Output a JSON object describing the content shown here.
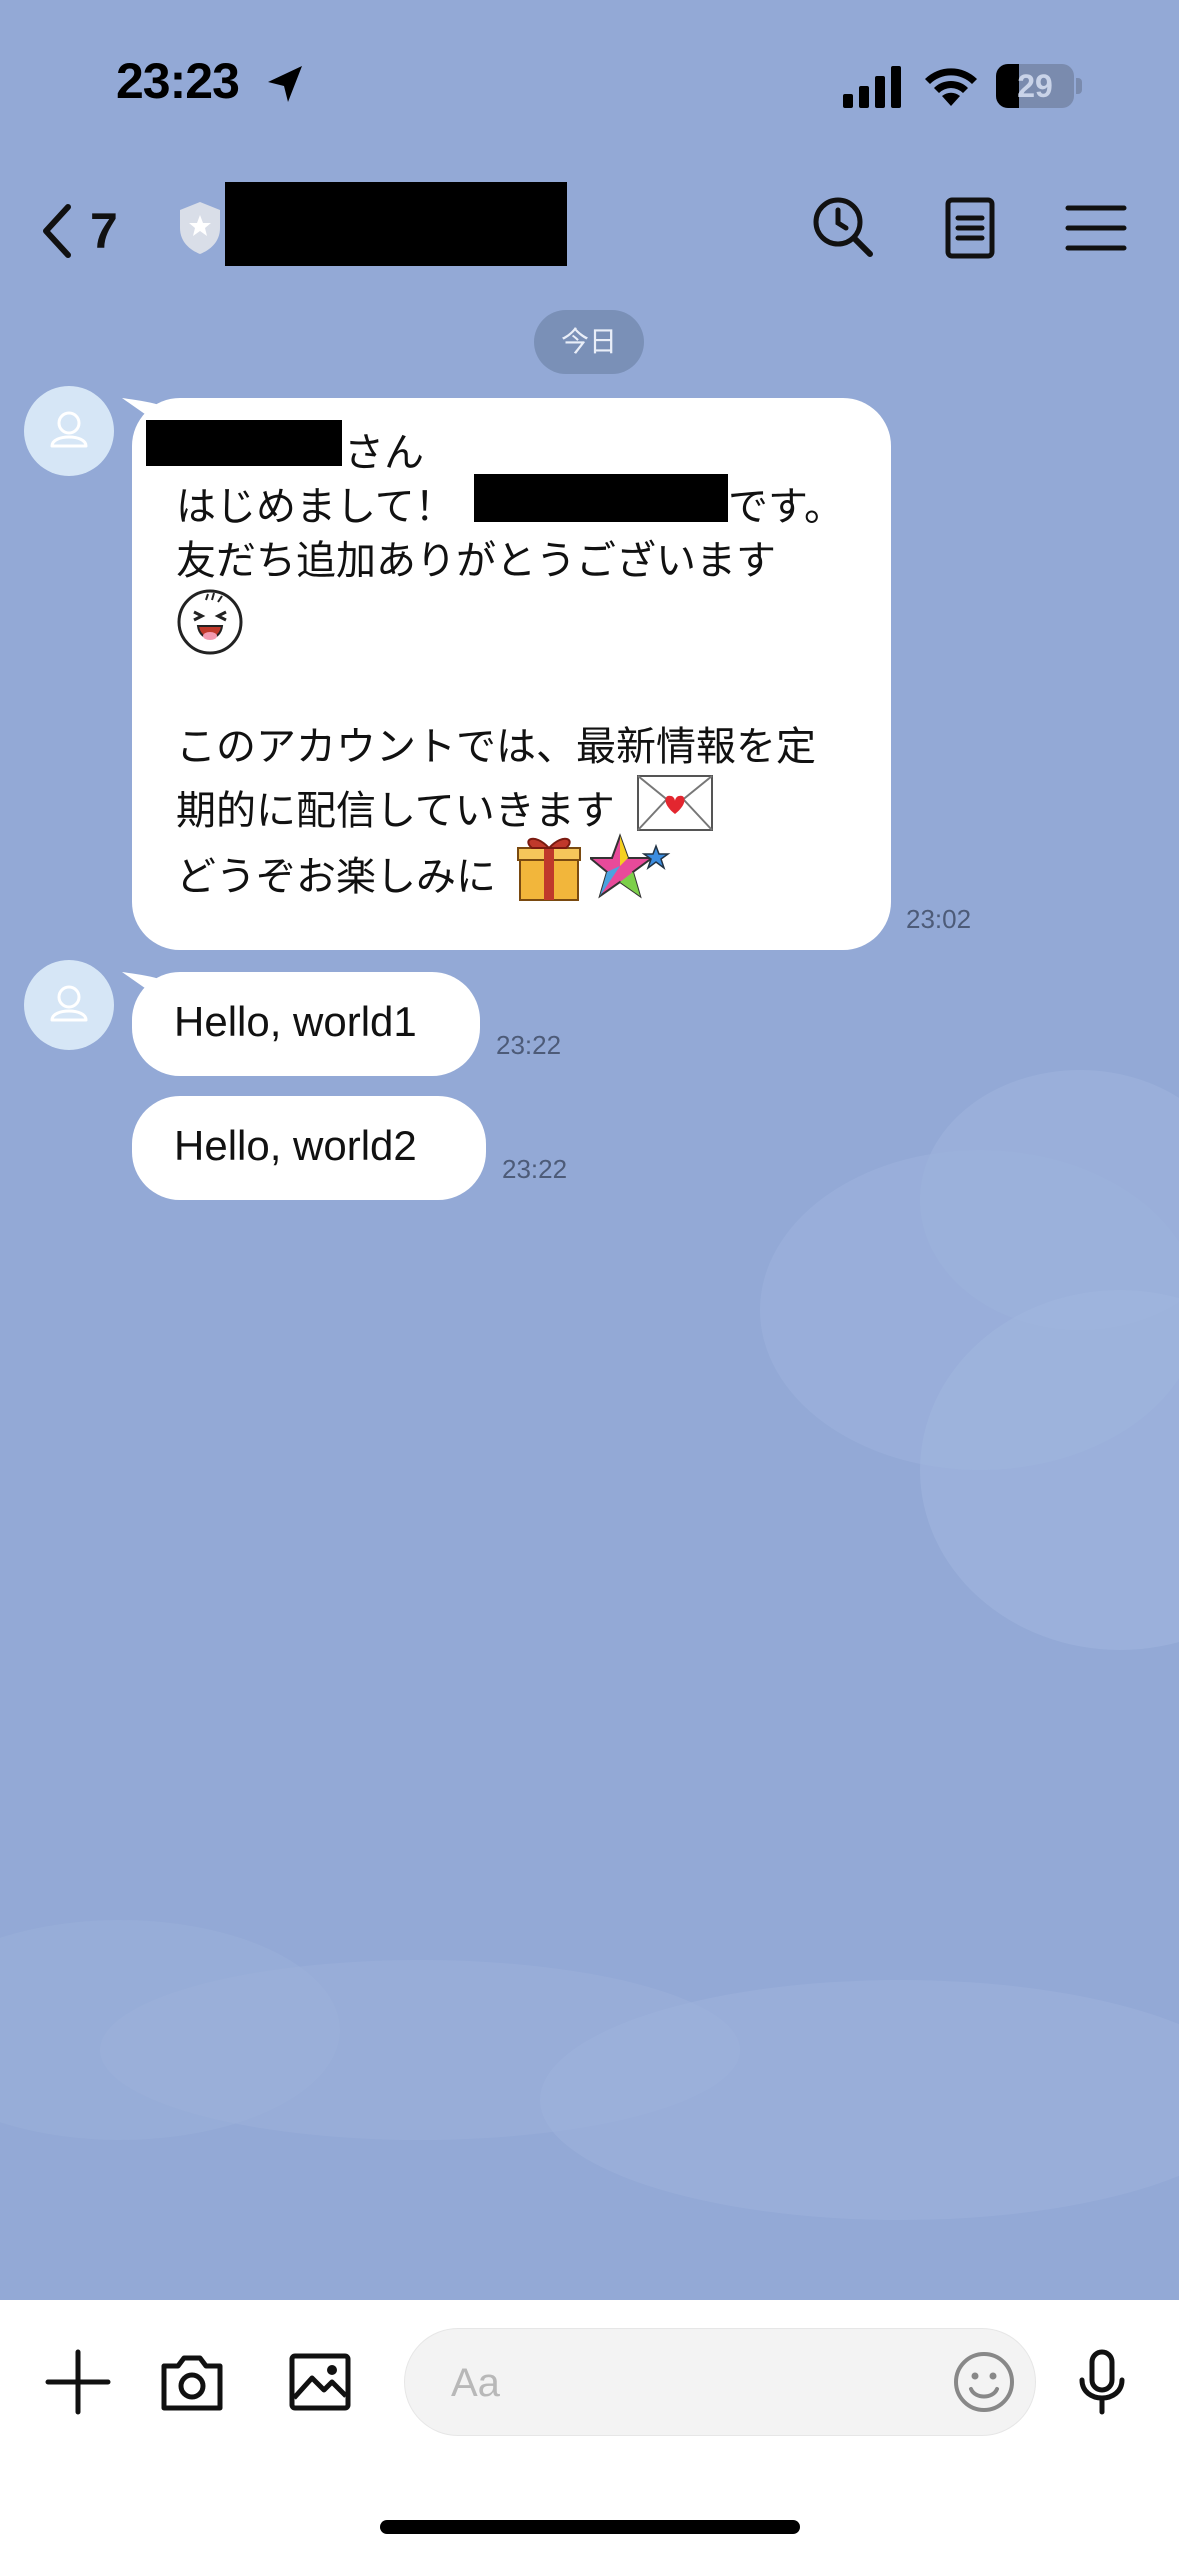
{
  "status_bar": {
    "time": "23:23",
    "battery_level": "29",
    "battery_fraction": 0.29
  },
  "header": {
    "back_count": "7",
    "icons": [
      "chevron-left-icon",
      "shield-icon",
      "search-icon",
      "notes-icon",
      "menu-icon"
    ]
  },
  "chat": {
    "date_label": "今日",
    "messages": [
      {
        "lines": [
          "さん",
          "はじめまして！",
          "です。",
          "友だち追加ありがとうございます",
          "このアカウントでは、最新情報を定",
          "期的に配信していきます",
          "どうぞお楽しみに"
        ],
        "emojis": [
          "laughing-face-sticker-icon",
          "love-letter-icon",
          "gift-icon",
          "shooting-star-icon"
        ],
        "time": "23:02"
      },
      {
        "text": "Hello, world1",
        "time": "23:22"
      },
      {
        "text": "Hello, world2",
        "time": "23:22"
      }
    ]
  },
  "input_bar": {
    "placeholder": "Aa",
    "icons": [
      "plus-icon",
      "camera-icon",
      "image-icon",
      "emoji-icon",
      "mic-icon"
    ]
  },
  "colors": {
    "background": "#93a9d6",
    "bubble": "#ffffff",
    "date_chip": "#7a90b7",
    "avatar": "#d6e6f6"
  }
}
